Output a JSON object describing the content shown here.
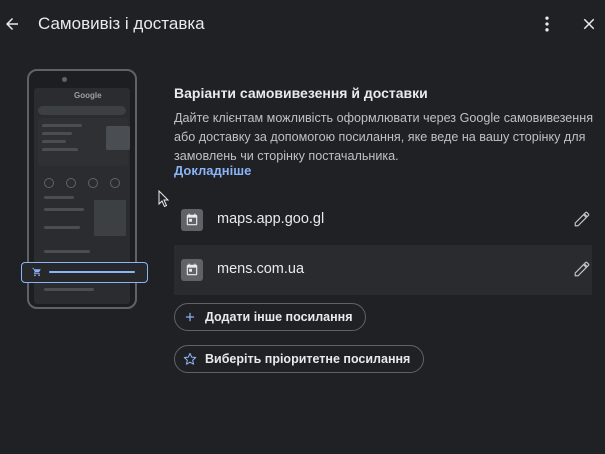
{
  "header": {
    "title": "Самовивіз і доставка",
    "back_icon": "arrow-left-icon",
    "more_icon": "more-vert-icon",
    "close_icon": "close-icon"
  },
  "illustration": {
    "logo_text": "Google"
  },
  "section": {
    "title": "Варіанти самовивезення й доставки",
    "description": "Дайте клієнтам можливість оформлювати через Google самовивезення або доставку за допомогою посилання, яке веде на вашу сторінку для замовлень чи сторінку постачальника.",
    "learn_more": "Докладніше"
  },
  "links": [
    {
      "url": "maps.app.goo.gl",
      "icon": "calendar-icon",
      "edit_icon": "pencil-icon"
    },
    {
      "url": "mens.com.ua",
      "icon": "calendar-icon",
      "edit_icon": "pencil-icon"
    }
  ],
  "actions": {
    "add_link": "Додати інше посилання",
    "choose_priority": "Виберіть пріоритетне посилання"
  },
  "colors": {
    "background": "#202124",
    "accent": "#8ab4f8",
    "text": "#e8eaed",
    "secondary_text": "#bdc1c6"
  }
}
